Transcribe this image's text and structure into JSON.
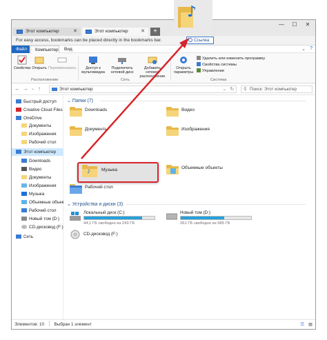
{
  "browser": {
    "tab_inactive": "Этот компьютер",
    "tab_active": "Этот компьютер",
    "new_tab": "+",
    "bookmarks_hint": "For easy access, bookmarks can be placed directly in the bookmarks bar.",
    "drag_chip_label": "Ссылка"
  },
  "ribbon": {
    "tabs": [
      "Файл",
      "Компьютер",
      "Вид"
    ],
    "location_group": {
      "label": "Расположение",
      "buttons": [
        "Свойства",
        "Открыть",
        "Переименовать"
      ]
    },
    "network_group": {
      "label": "Сеть",
      "buttons": [
        "Доступ к мультимедиа",
        "Подключить сетевой диск",
        "Добавить сетевое расположение"
      ]
    },
    "system_group": {
      "label": "Система",
      "open_params": "Открыть параметры",
      "items": [
        "Удалить или изменить программу",
        "Свойства системы",
        "Управление"
      ]
    }
  },
  "address": {
    "path": "Этот компьютер",
    "search_placeholder": "Поиск: Этот компьютер"
  },
  "sidebar": {
    "items": [
      {
        "label": "Быстрый доступ",
        "icon": "star-icon"
      },
      {
        "label": "Creative Cloud Files",
        "icon": "cloud-icon"
      },
      {
        "label": "OneDrive",
        "icon": "cloud-icon"
      },
      {
        "label": "Документы",
        "icon": "folder-icon"
      },
      {
        "label": "Изображения",
        "icon": "folder-icon"
      },
      {
        "label": "Рабочий стол",
        "icon": "folder-icon"
      },
      {
        "label": "Этот компьютер",
        "icon": "computer-icon"
      },
      {
        "label": "Downloads",
        "icon": "download-icon"
      },
      {
        "label": "Видео",
        "icon": "video-icon"
      },
      {
        "label": "Документы",
        "icon": "folder-icon"
      },
      {
        "label": "Изображения",
        "icon": "image-icon"
      },
      {
        "label": "Музыка",
        "icon": "music-icon"
      },
      {
        "label": "Объемные объекты",
        "icon": "cube-icon"
      },
      {
        "label": "Рабочий стол",
        "icon": "folder-icon"
      },
      {
        "label": "Новый том (D:)",
        "icon": "drive-icon"
      },
      {
        "label": "CD-дисковод (F:)",
        "icon": "cd-icon"
      },
      {
        "label": "Сеть",
        "icon": "network-icon"
      }
    ]
  },
  "folders": {
    "heading": "Папки (7)",
    "items": [
      "Downloads",
      "Видео",
      "Документы",
      "Изображения",
      "Музыка",
      "Объемные объекты",
      "Рабочий стол"
    ]
  },
  "devices": {
    "heading": "Устройства и диски (3)",
    "drives": [
      {
        "name": "Локальный диск (C:)",
        "info": "44,1 ГБ свободно из 243 ГБ",
        "used_fraction": 0.82
      },
      {
        "name": "Новый том (D:)",
        "info": "261 ГБ свободно из 685 ГБ",
        "used_fraction": 0.62
      },
      {
        "name": "CD-дисковод (F:)",
        "info": ""
      }
    ]
  },
  "status": {
    "items_count": "Элементов: 10",
    "selected": "Выбран 1 элемент"
  },
  "colors": {
    "accent": "#1f69c1",
    "highlight_border": "#d9232a",
    "drive_fill": "#26a0da"
  }
}
